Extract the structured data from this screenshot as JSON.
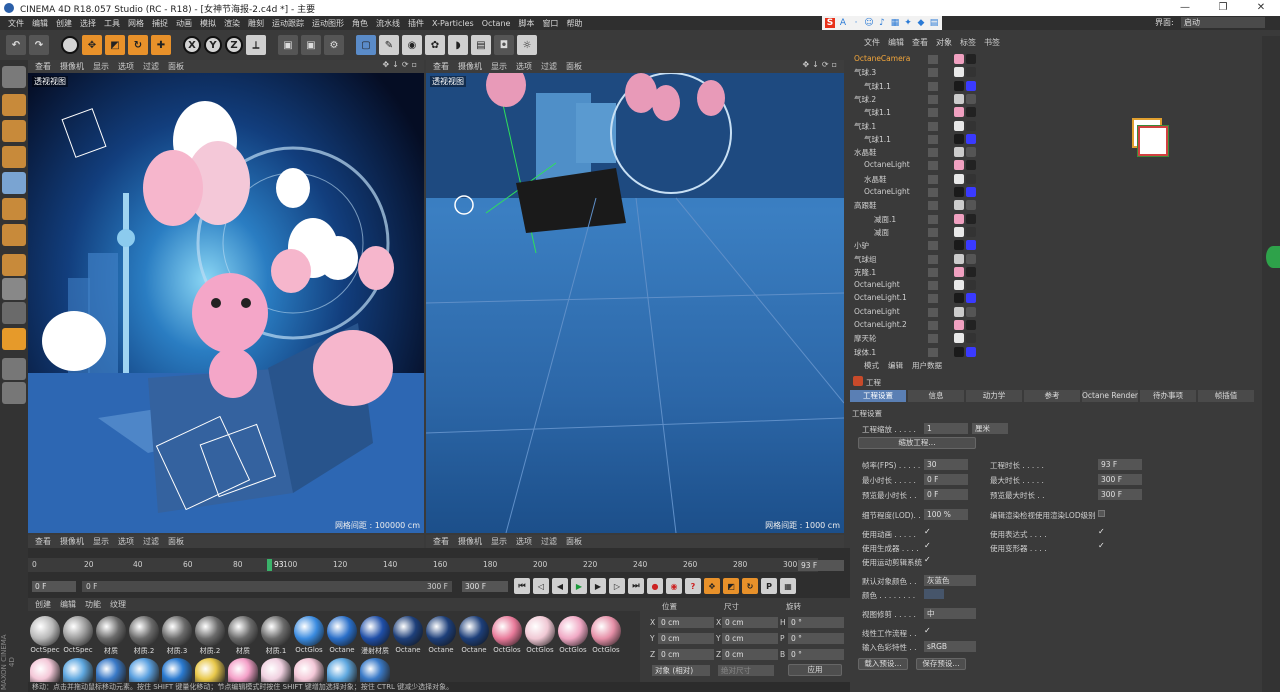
{
  "title": "CINEMA 4D R18.057 Studio (RC - R18) - [女神节海报-2.c4d *] - 主要",
  "window_controls": [
    "—",
    "❐",
    "✕"
  ],
  "menu": [
    "文件",
    "编辑",
    "创建",
    "选择",
    "工具",
    "网格",
    "捕捉",
    "动画",
    "模拟",
    "渲染",
    "雕刻",
    "运动跟踪",
    "运动图形",
    "角色",
    "流水线",
    "插件",
    "X-Particles",
    "Octane",
    "脚本",
    "窗口",
    "帮助"
  ],
  "layout": {
    "label": "界面:",
    "value": "启动"
  },
  "viewport_left": {
    "menus": [
      "查看",
      "摄像机",
      "显示",
      "选项",
      "过滤",
      "面板"
    ],
    "label": "透视视图",
    "grid": "网格间距 : 100000 cm"
  },
  "viewport_right": {
    "menus": [
      "查看",
      "摄像机",
      "显示",
      "选项",
      "过滤",
      "面板"
    ],
    "label": "透视视图",
    "grid": "网格间距 : 1000 cm"
  },
  "viewport_bottom_left": {
    "menus": [
      "查看",
      "摄像机",
      "显示",
      "选项",
      "过滤",
      "面板"
    ]
  },
  "viewport_bottom_right": {
    "menus": [
      "查看",
      "摄像机",
      "显示",
      "选项",
      "过滤",
      "面板"
    ]
  },
  "object_manager": {
    "tabs": [
      "文件",
      "编辑",
      "查看",
      "对象",
      "标签",
      "书签"
    ],
    "objects": [
      {
        "name": "OctaneCamera",
        "indent": 0,
        "highlight": true
      },
      {
        "name": "气球.3",
        "indent": 0
      },
      {
        "name": "气球1.1",
        "indent": 1
      },
      {
        "name": "气球.2",
        "indent": 0
      },
      {
        "name": "气球1.1",
        "indent": 1
      },
      {
        "name": "气球.1",
        "indent": 0
      },
      {
        "name": "气球1.1",
        "indent": 1
      },
      {
        "name": "水晶鞋",
        "indent": 0
      },
      {
        "name": "OctaneLight",
        "indent": 1
      },
      {
        "name": "水晶鞋",
        "indent": 1
      },
      {
        "name": "OctaneLight",
        "indent": 1
      },
      {
        "name": "高跟鞋",
        "indent": 0
      },
      {
        "name": "减面.1",
        "indent": 2
      },
      {
        "name": "减面",
        "indent": 2
      },
      {
        "name": "小驴",
        "indent": 0
      },
      {
        "name": "气球组",
        "indent": 0
      },
      {
        "name": "克隆.1",
        "indent": 0
      },
      {
        "name": "OctaneLight",
        "indent": 0
      },
      {
        "name": "OctaneLight.1",
        "indent": 0
      },
      {
        "name": "OctaneLight",
        "indent": 0
      },
      {
        "name": "OctaneLight.2",
        "indent": 0
      },
      {
        "name": "摩天轮",
        "indent": 0
      },
      {
        "name": "球体.1",
        "indent": 0
      }
    ]
  },
  "attribute_manager": {
    "tabs": [
      "模式",
      "编辑",
      "用户数据"
    ],
    "header": "工程",
    "subtabs": [
      "工程设置",
      "信息",
      "动力学",
      "参考",
      "Octane Render",
      "待办事项",
      "帧插值"
    ],
    "section": "工程设置",
    "scale_label": "工程缩放 . . . . .",
    "scale_value": "1",
    "scale_unit": "厘米",
    "scale_button": "缩放工程...",
    "fps_label": "帧率(FPS) . . . . .",
    "fps_value": "30",
    "duration_label": "工程时长 . . . . .",
    "duration_value": "93 F",
    "min_label": "最小时长 . . . . .",
    "min_value": "0 F",
    "max_label": "最大时长 . . . . .",
    "max_value": "300 F",
    "pmin_label": "预览最小时长 . .",
    "pmin_value": "0 F",
    "pmax_label": "预览最大时长 . .",
    "pmax_value": "300 F",
    "lod_label": "细节程度(LOD). .",
    "lod_value": "100 %",
    "lod_render_label": "编辑渲染检视使用渲染LOD级别",
    "use_anim": "使用动画 . . . . .",
    "use_expr": "使用表达式 . . . .",
    "use_gen": "使用生成器 . . . .",
    "use_deform": "使用变形器 . . . .",
    "use_motion": "使用运动剪辑系统",
    "default_color_label": "默认对象颜色 . .",
    "default_color_value": "灰蓝色",
    "color_label": "颜色 . . . . . . . .",
    "clip_label": "视图修剪 . . . . .",
    "clip_value": "中",
    "linear_label": "线性工作流程 . .",
    "input_label": "输入色彩特性 . .",
    "input_value": "sRGB",
    "load_preset": "载入预设...",
    "save_preset": "保存预设..."
  },
  "timeline": {
    "ticks": [
      "0",
      "20",
      "40",
      "60",
      "80",
      "100",
      "120",
      "140",
      "160",
      "180",
      "200",
      "220",
      "240",
      "260",
      "280",
      "300"
    ],
    "current": "93",
    "current_field": "93 F",
    "start": "0 F",
    "range_start": "0 F",
    "range_end": "300 F",
    "end": "300 F"
  },
  "material_manager": {
    "menus": [
      "创建",
      "编辑",
      "功能",
      "纹理"
    ],
    "materials": [
      {
        "name": "OctSpec",
        "color": "#b8b8b8"
      },
      {
        "name": "OctSpec",
        "color": "#9a9a9a"
      },
      {
        "name": "材质",
        "color": "#6a6a6a"
      },
      {
        "name": "材质.2",
        "color": "#6a6a6a"
      },
      {
        "name": "材质.3",
        "color": "#6a6a6a"
      },
      {
        "name": "材质.2",
        "color": "#6a6a6a"
      },
      {
        "name": "材质",
        "color": "#6a6a6a"
      },
      {
        "name": "材质.1",
        "color": "#6a6a6a"
      },
      {
        "name": "OctGlos",
        "color": "#3a8be0"
      },
      {
        "name": "Octane",
        "color": "#2a6fc9"
      },
      {
        "name": "漫射材质",
        "color": "#1f4fa8"
      },
      {
        "name": "Octane",
        "color": "#1d3f7a"
      },
      {
        "name": "Octane",
        "color": "#1d3f7a"
      },
      {
        "name": "Octane",
        "color": "#1d3f7a"
      },
      {
        "name": "OctGlos",
        "color": "#e87a9a"
      },
      {
        "name": "OctGlos",
        "color": "#f0c8d4"
      },
      {
        "name": "OctGlos",
        "color": "#f0a8c4"
      },
      {
        "name": "OctGlos",
        "color": "#e690a8"
      }
    ]
  },
  "coords": {
    "headers": [
      "位置",
      "尺寸",
      "旋转"
    ],
    "rows": [
      {
        "axis": "X",
        "pos": "0 cm",
        "size": "0 cm",
        "rlabel": "H",
        "rot": "0 °"
      },
      {
        "axis": "Y",
        "pos": "0 cm",
        "size": "0 cm",
        "rlabel": "P",
        "rot": "0 °"
      },
      {
        "axis": "Z",
        "pos": "0 cm",
        "size": "0 cm",
        "rlabel": "B",
        "rot": "0 °"
      }
    ],
    "mode": "对象 (相对)",
    "size_mode": "绝对尺寸",
    "apply": "应用"
  },
  "status": "移动：点击并拖动鼠标移动元素。按住 SHIFT 键量化移动；节点编辑模式时按住 SHIFT 键增加选择对象；按住 CTRL 键减少选择对象。",
  "brand": "MAXON CINEMA 4D",
  "colors": {
    "accent": "#5a7fb4",
    "highlight": "#f4a73b",
    "timeline_marker": "#3ab26a"
  }
}
